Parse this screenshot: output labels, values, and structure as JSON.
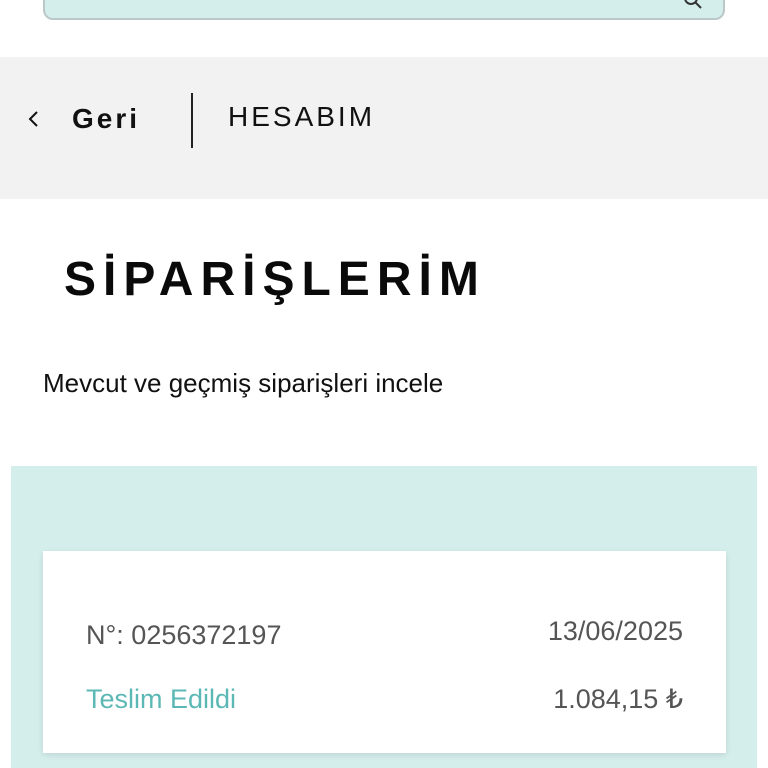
{
  "search": {
    "icon": "search-icon",
    "background": "#d4eeec"
  },
  "nav": {
    "back_icon": "chevron-left-icon",
    "back_label": "Geri",
    "account_label": "HESABIM"
  },
  "page": {
    "title": "SİPARİŞLERİM",
    "subtitle": "Mevcut ve geçmiş siparişleri incele"
  },
  "orders": [
    {
      "number": "N°: 0256372197",
      "date": "13/06/2025",
      "status": "Teslim Edildi",
      "total": "1.084,15 ₺"
    }
  ],
  "colors": {
    "accent": "#5bb8b4",
    "section_bg": "#d4eeec",
    "navbar_bg": "#f2f2f2"
  }
}
